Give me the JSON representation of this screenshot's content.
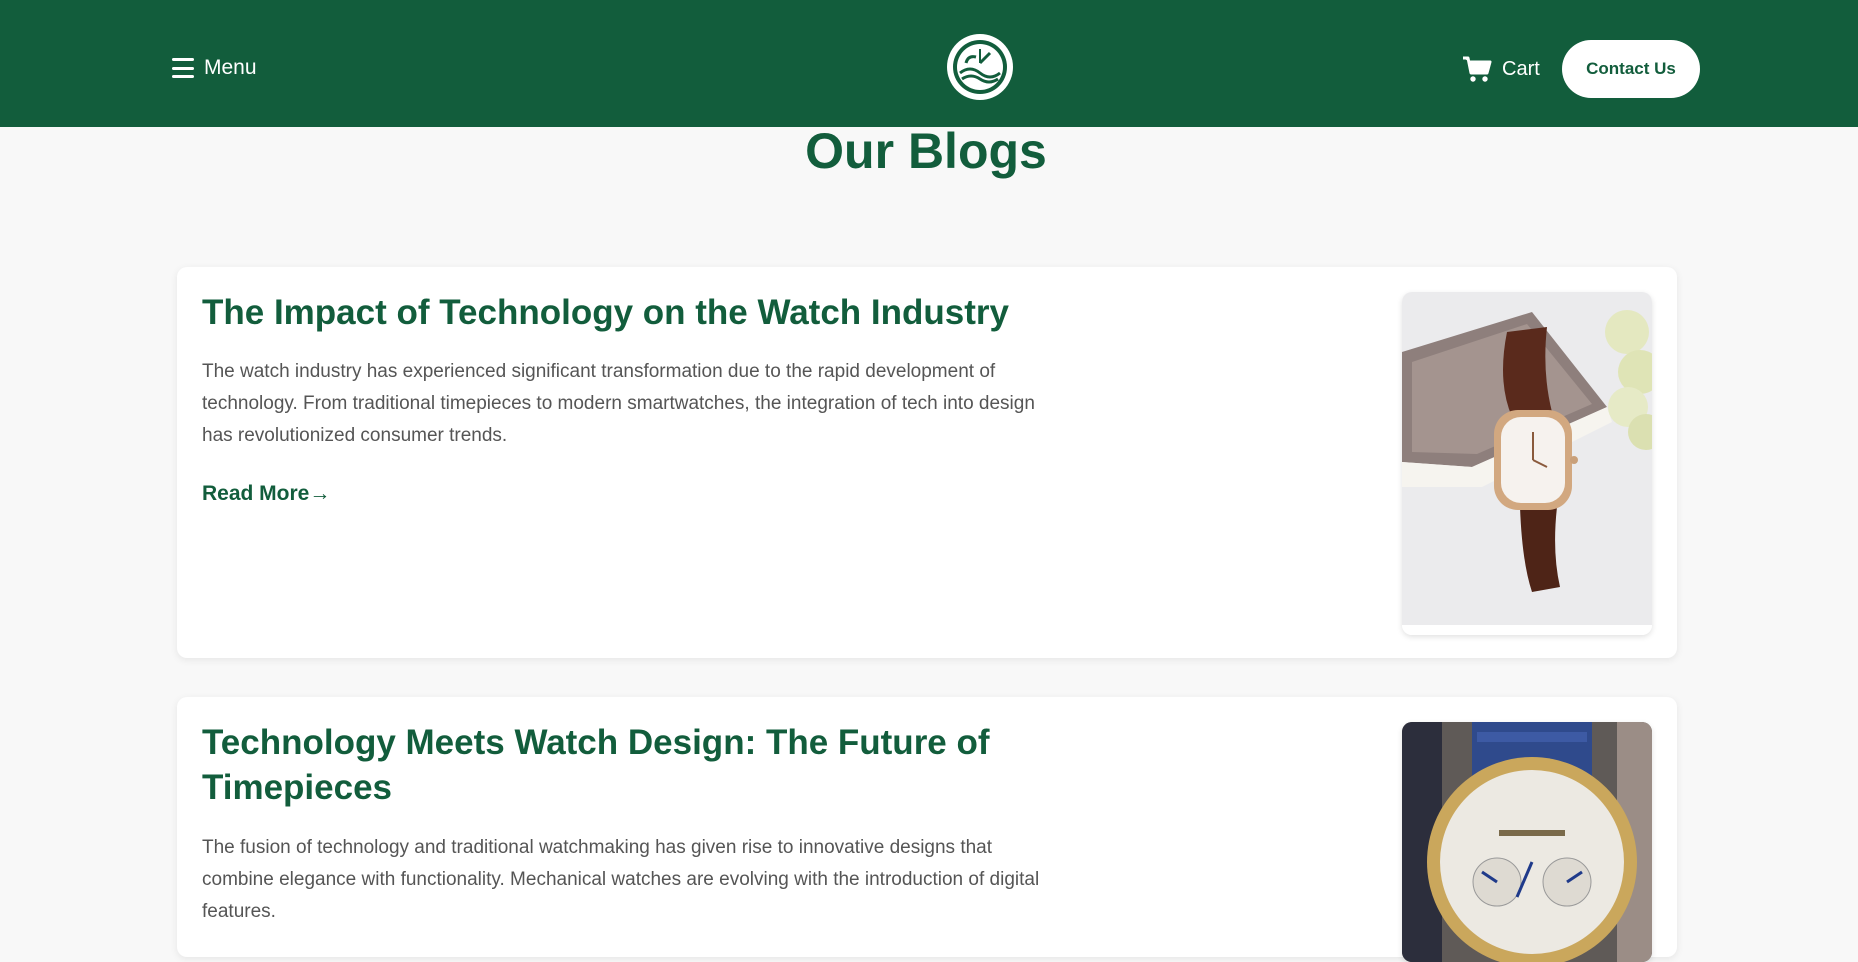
{
  "header": {
    "menu_label": "Menu",
    "cart_label": "Cart",
    "contact_label": "Contact Us"
  },
  "page": {
    "title": "Our Blogs"
  },
  "posts": [
    {
      "title": "The Impact of Technology on the Watch Industry",
      "excerpt": "The watch industry has experienced significant transformation due to the rapid development of technology. From traditional timepieces to modern smartwatches, the integration of tech into design has revolutionized consumer trends.",
      "link_label": "Read More→"
    },
    {
      "title": "Technology Meets Watch Design: The Future of Timepieces",
      "excerpt": "The fusion of technology and traditional watchmaking has given rise to innovative designs that combine elegance with functionality. Mechanical watches are evolving with the introduction of digital features."
    }
  ],
  "colors": {
    "brand_green": "#125d3c",
    "background": "#f8f8f8",
    "card": "#ffffff",
    "body_text": "#555555"
  },
  "icons": [
    "menu-icon",
    "logo-watch-icon",
    "cart-icon"
  ]
}
